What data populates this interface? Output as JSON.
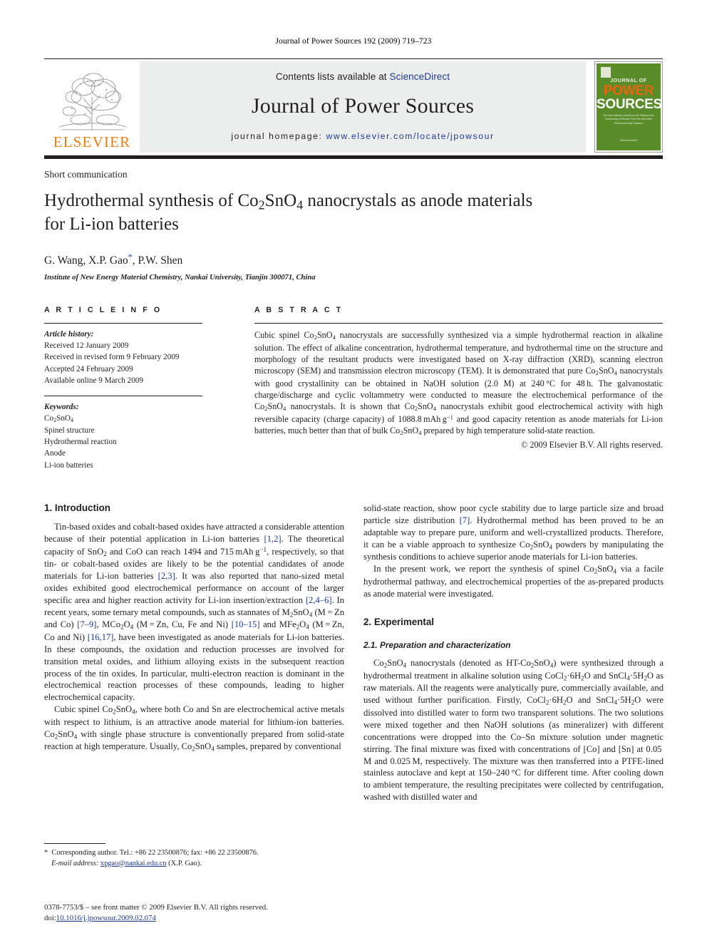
{
  "running_head": "Journal of Power Sources 192 (2009) 719–723",
  "masthead": {
    "contents_prefix": "Contents lists available at ",
    "contents_link": "ScienceDirect",
    "journal_name": "Journal of Power Sources",
    "homepage_prefix": "journal homepage:",
    "homepage_url": "www.elsevier.com/locate/jpowsour",
    "publisher_logo_text": "ELSEVIER",
    "cover": {
      "journal_of": "JOURNAL OF",
      "power": "POWER",
      "sources": "SOURCES",
      "subtitle": "The International Journal on the Science and Technology of Electric Fuel Cell and other Electrochemical Systems",
      "sciencedirect": "ScienceDirect"
    }
  },
  "article": {
    "doc_type": "Short communication",
    "title_line1": "Hydrothermal synthesis of Co2SnO4 nanocrystals as anode materials",
    "title_line2": "for Li-ion batteries",
    "authors": "G. Wang, X.P. Gao",
    "authors_tail": ", P.W. Shen",
    "corresponding_marker": "*",
    "affiliation": "Institute of New Energy Material Chemistry, Nankai University, Tianjin 300071, China"
  },
  "article_info": {
    "section_label": "A R T I C L E    I N F O",
    "history_label": "Article history:",
    "history": [
      "Received 12 January 2009",
      "Received in revised form 9 February 2009",
      "Accepted 24 February 2009",
      "Available online 9 March 2009"
    ],
    "keywords_label": "Keywords:",
    "keywords": [
      "Co2SnO4",
      "Spinel structure",
      "Hydrothermal reaction",
      "Anode",
      "Li-ion batteries"
    ]
  },
  "abstract": {
    "section_label": "A B S T R A C T",
    "text": "Cubic spinel Co2SnO4 nanocrystals are successfully synthesized via a simple hydrothermal reaction in alkaline solution. The effect of alkaline concentration, hydrothermal temperature, and hydrothermal time on the structure and morphology of the resultant products were investigated based on X-ray diffraction (XRD), scanning electron microscopy (SEM) and transmission electron microscopy (TEM). It is demonstrated that pure Co2SnO4 nanocrystals with good crystallinity can be obtained in NaOH solution (2.0 M) at 240 °C for 48 h. The galvanostatic charge/discharge and cyclic voltammetry were conducted to measure the electrochemical performance of the Co2SnO4 nanocrystals. It is shown that Co2SnO4 nanocrystals exhibit good electrochemical activity with high reversible capacity (charge capacity) of 1088.8 mAh g−1 and good capacity retention as anode materials for Li-ion batteries, much better than that of bulk Co2SnO4 prepared by high temperature solid-state reaction.",
    "copyright": "© 2009 Elsevier B.V. All rights reserved."
  },
  "sections": {
    "introduction_heading": "1.  Introduction",
    "intro_p1": "Tin-based oxides and cobalt-based oxides have attracted a considerable attention because of their potential application in Li-ion batteries [1,2]. The theoretical capacity of SnO2 and CoO can reach 1494 and 715 mAh g−1, respectively, so that tin- or cobalt-based oxides are likely to be the potential candidates of anode materials for Li-ion batteries [2,3]. It was also reported that nano-sized metal oxides exhibited good electrochemical performance on account of the larger specific area and higher reaction activity for Li-ion insertion/extraction [2,4–6]. In recent years, some ternary metal compounds, such as stannates of M2SnO4 (M = Zn and Co) [7–9], MCo2O4 (M = Zn, Cu, Fe and Ni) [10–15] and MFe2O4 (M = Zn, Co and Ni) [16,17], have been investigated as anode materials for Li-ion batteries. In these compounds, the oxidation and reduction processes are involved for transition metal oxides, and lithium alloying exists in the subsequent reaction process of the tin oxides. In particular, multi-electron reaction is dominant in the electrochemical reaction processes of these compounds, leading to higher electrochemical capacity.",
    "intro_p2": "Cubic spinel Co2SnO4, where both Co and Sn are electrochemical active metals with respect to lithium, is an attractive anode material for lithium-ion batteries. Co2SnO4 with single phase structure is conventionally prepared from solid-state reaction at high temperature. Usually, Co2SnO4 samples, prepared by conventional",
    "intro_p3": "solid-state reaction, show poor cycle stability due to large particle size and broad particle size distribution [7]. Hydrothermal method has been proved to be an adaptable way to prepare pure, uniform and well-crystallized products. Therefore, it can be a viable approach to synthesize Co2SnO4 powders by manipulating the synthesis conditions to achieve superior anode materials for Li-ion batteries.",
    "intro_p4": "In the present work, we report the synthesis of spinel Co2SnO4 via a facile hydrothermal pathway, and electrochemical properties of the as-prepared products as anode material were investigated.",
    "experimental_heading": "2.  Experimental",
    "preparation_heading": "2.1.  Preparation and characterization",
    "exp_p1": "Co2SnO4 nanocrystals (denoted as HT-Co2SnO4) were synthesized through a hydrothermal treatment in alkaline solution using CoCl2·6H2O and SnCl4·5H2O as raw materials. All the reagents were analytically pure, commercially available, and used without further purification. Firstly, CoCl2·6H2O and SnCl4·5H2O were dissolved into distilled water to form two transparent solutions. The two solutions were mixed together and then NaOH solutions (as mineralizer) with different concentrations were dropped into the Co–Sn mixture solution under magnetic stirring. The final mixture was fixed with concentrations of [Co] and [Sn] at 0.05 M and 0.025 M, respectively. The mixture was then transferred into a PTFE-lined stainless autoclave and kept at 150–240 °C for different time. After cooling down to ambient temperature, the resulting precipitates were collected by centrifugation, washed with distilled water and"
  },
  "footnote": {
    "marker": "*",
    "corresponding": "Corresponding author. Tel.: +86 22 23500876; fax: +86 22 23500876.",
    "email_label": "E-mail address:",
    "email": "xpgao@nankai.edu.cn",
    "email_owner": "(X.P. Gao)."
  },
  "page_footer": {
    "issn_line": "0378-7753/$ – see front matter © 2009 Elsevier B.V. All rights reserved.",
    "doi_label": "doi:",
    "doi": "10.1016/j.jpowsour.2009.02.074"
  },
  "colors": {
    "link_blue": "#1f3a93",
    "elsevier_orange": "#f07d10",
    "cover_green": "#5b8c2a",
    "masthead_grey": "#eceded",
    "text": "#231f20"
  }
}
